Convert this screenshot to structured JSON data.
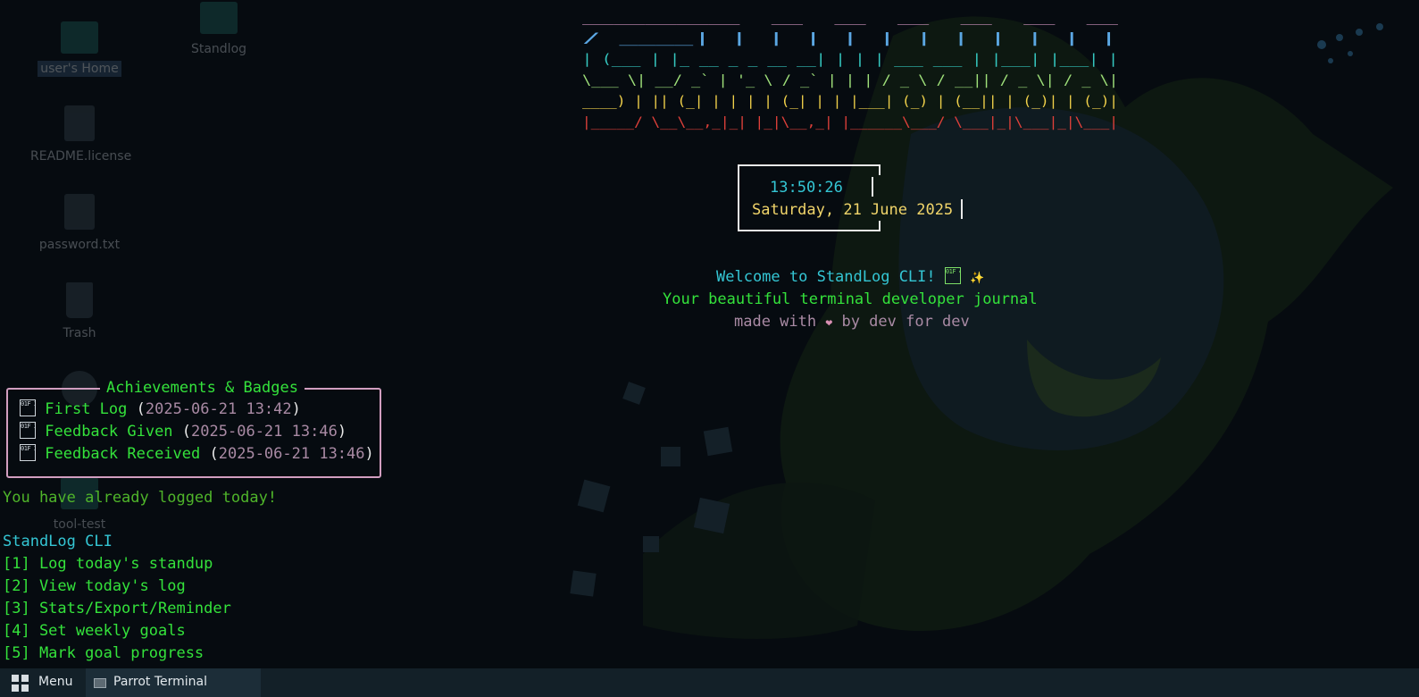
{
  "desktop": {
    "icons": [
      {
        "label": "user's Home",
        "selected": true
      },
      {
        "label": "Standlog"
      },
      {
        "label": "README.license"
      },
      {
        "label": "password.txt"
      },
      {
        "label": "Trash"
      },
      {
        "label": "tool-test"
      }
    ]
  },
  "banner": {
    "text": "StandLog CLI",
    "lines": [
      {
        "text": "  _____ _                  _    _                 _     _     _ ",
        "color": "#c98fb8"
      },
      {
        "text": " / ____| |                | |  | |               | |   | |   | |",
        "color": "#5ba7e3"
      },
      {
        "text": "| (___ | |_ __ _ _ __   __| |  | |     ___   ___ | |___| |___| |",
        "color": "#35c7c0"
      },
      {
        "text": " \\___ \\| __/ _` | '_ \\ / _` |  | |    / _ \\ / __|| / _ \\| / _ \\|",
        "color": "#9fe07a"
      },
      {
        "text": " ____) | || (_| | | | | (_| |  | |___| (_) | (__|| | (_)| | (_)|",
        "color": "#f0d04a"
      },
      {
        "text": "|_____/ \\__\\__,_|_| |_|\\__,_|  |______\\___/ \\___|_|\\___|_|\\___|",
        "color": "#e0403a"
      }
    ]
  },
  "clock": {
    "time": "13:50:26",
    "date": "Saturday, 21 June 2025"
  },
  "welcome": {
    "title": "Welcome to StandLog CLI!",
    "emoji_code": "01F 4DD",
    "sparkle": "✨",
    "subtitle": "Your beautiful terminal developer journal",
    "made_prefix": "made with",
    "heart": "❤",
    "made_suffix": "by dev for dev"
  },
  "achievements": {
    "title": "Achievements & Badges",
    "badge_code": "01F 3C5",
    "items": [
      {
        "name": "First Log",
        "time": "2025-06-21 13:42"
      },
      {
        "name": "Feedback Given",
        "time": "2025-06-21 13:46"
      },
      {
        "name": "Feedback Received",
        "time": "2025-06-21 13:46"
      }
    ]
  },
  "status_message": "You have already logged today!",
  "menu": {
    "title": "StandLog CLI",
    "items": [
      "[1] Log today's standup",
      "[2] View today's log",
      "[3] Stats/Export/Reminder",
      "[4] Set weekly goals",
      "[5] Mark goal progress"
    ]
  },
  "taskbar": {
    "menu_label": "Menu",
    "task_label": "Parrot Terminal"
  },
  "colors": {
    "cyan": "#34c6d4",
    "yellow": "#f1d56a",
    "green": "#34e23b",
    "olive": "#4fb52a",
    "mauve": "#a98aa4",
    "border_pink": "#d19ec0"
  }
}
